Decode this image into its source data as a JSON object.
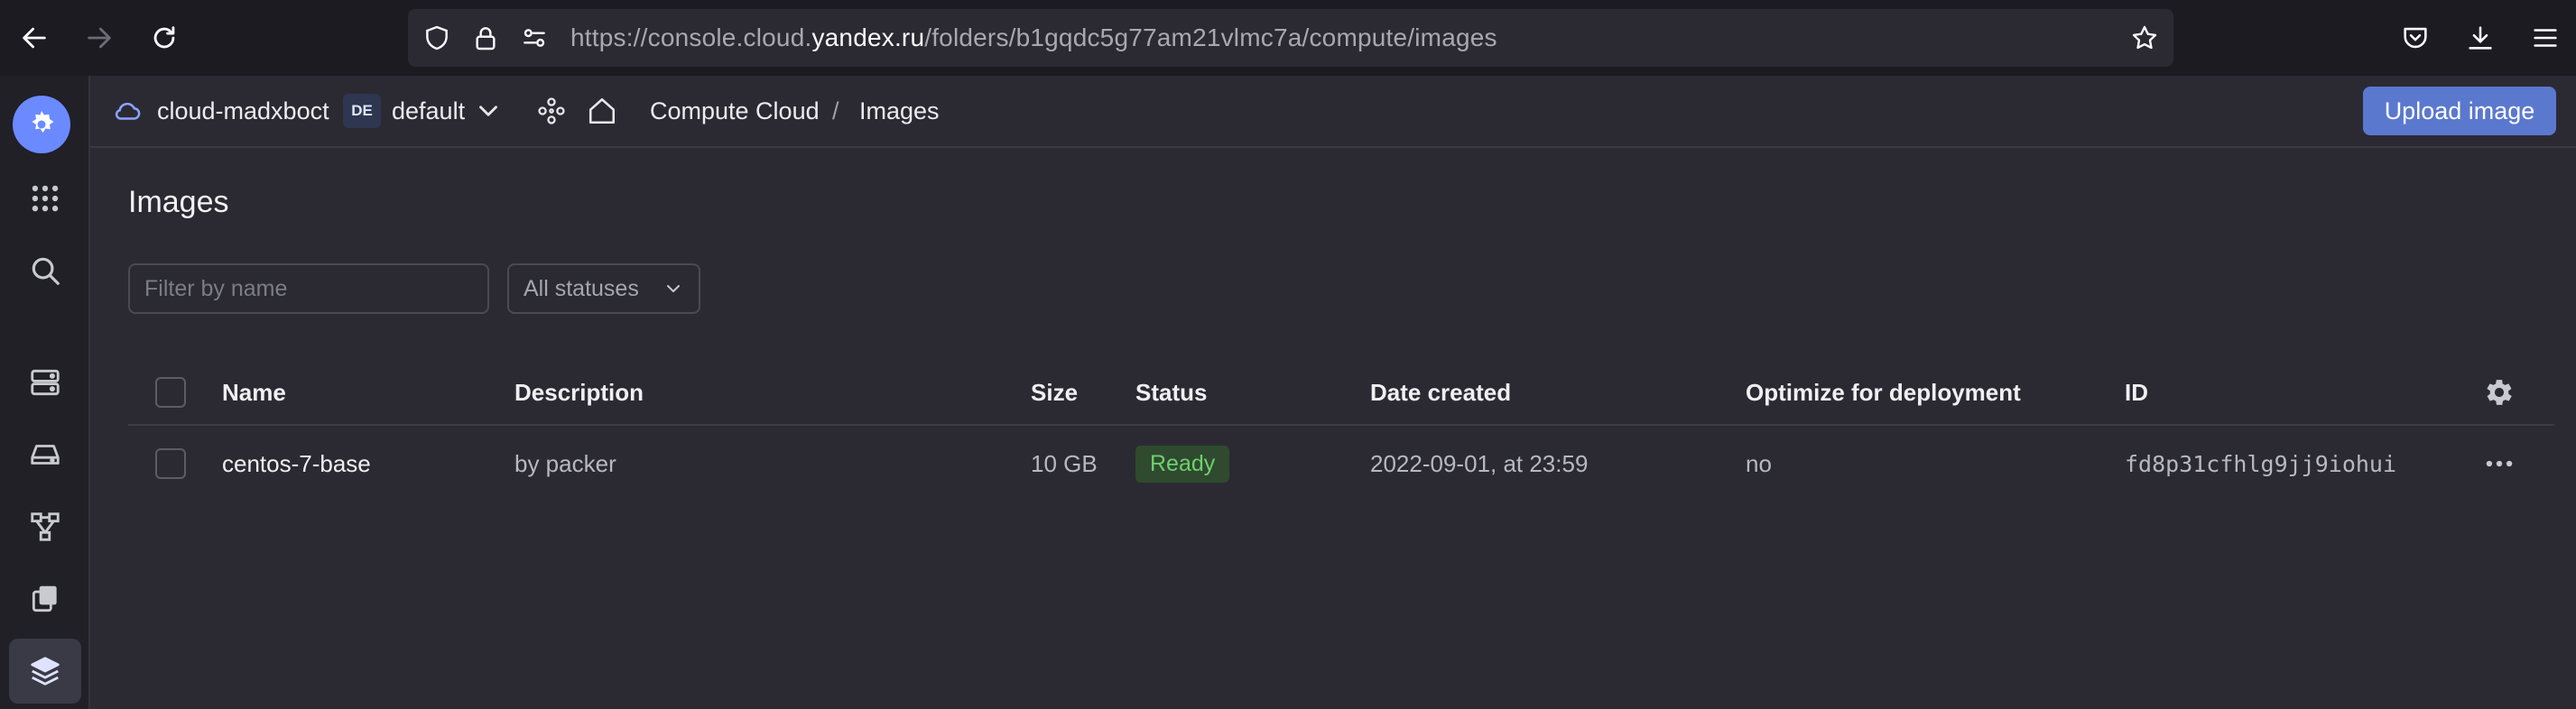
{
  "browser": {
    "url_prefix": "https://console.cloud.",
    "url_domain": "yandex.ru",
    "url_suffix": "/folders/b1gqdc5g77am21vlmc7a/compute/images"
  },
  "header": {
    "cloud_name": "cloud-madxboct",
    "folder_badge": "DE",
    "folder_name": "default",
    "breadcrumb_service": "Compute Cloud",
    "breadcrumb_separator": "/",
    "breadcrumb_page": "Images",
    "upload_label": "Upload image"
  },
  "page": {
    "title": "Images",
    "filter_placeholder": "Filter by name",
    "status_filter": "All statuses"
  },
  "table": {
    "columns": [
      "Name",
      "Description",
      "Size",
      "Status",
      "Date created",
      "Optimize for deployment",
      "ID"
    ],
    "rows": [
      {
        "name": "centos-7-base",
        "description": "by packer",
        "size": "10 GB",
        "status": "Ready",
        "date_created": "2022-09-01, at 23:59",
        "optimize": "no",
        "id": "fd8p31cfhlg9jj9iohui"
      }
    ]
  },
  "colors": {
    "accent": "#5a78ce",
    "status_ready": "#6fcf6f",
    "background": "#2b2a33"
  }
}
